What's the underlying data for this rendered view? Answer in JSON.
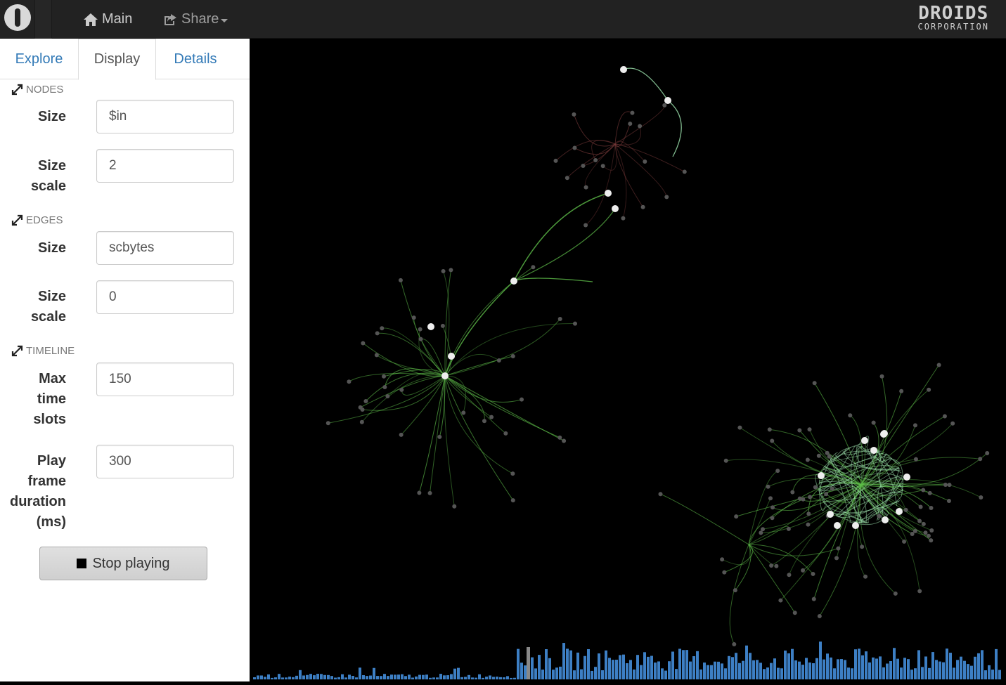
{
  "navbar": {
    "brand_icon": "droid-logo-icon",
    "items": [
      {
        "label": "Main",
        "icon": "home-icon"
      },
      {
        "label": "Share",
        "icon": "share-icon"
      }
    ],
    "logo_line1": "DROIDS",
    "logo_line2": "CORPORATION"
  },
  "sidebar": {
    "tabs": [
      {
        "label": "Explore",
        "active": false
      },
      {
        "label": "Display",
        "active": true
      },
      {
        "label": "Details",
        "active": false
      }
    ],
    "nodes": {
      "heading": "NODES",
      "size_label": "Size",
      "size_value": "$in",
      "size_scale_label_1": "Size",
      "size_scale_label_2": "scale",
      "size_scale_value": "2"
    },
    "edges": {
      "heading": "EDGES",
      "size_label": "Size",
      "size_value": "scbytes",
      "size_scale_label_1": "Size",
      "size_scale_label_2": "scale",
      "size_scale_value": "0"
    },
    "timeline": {
      "heading": "TIMELINE",
      "max_slots_label_1": "Max",
      "max_slots_label_2": "time",
      "max_slots_label_3": "slots",
      "max_slots_value": "150",
      "frame_label_1": "Play",
      "frame_label_2": "frame",
      "frame_label_3": "duration",
      "frame_label_4": "(ms)",
      "frame_value": "300"
    },
    "stop_button": "Stop playing"
  },
  "graph": {
    "background": "#000000",
    "edge_color": "#5fbf4a",
    "highlight_edge": "#9fe6b0",
    "node_color": "#eeeeee",
    "dim_node_color": "#555555",
    "timeline_bar_color": "#3d7fc4",
    "timeline_cursor_color": "#888888"
  }
}
